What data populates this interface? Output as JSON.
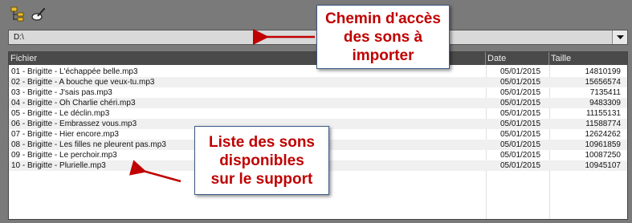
{
  "path": {
    "value": "D:\\"
  },
  "columns": {
    "file": "Fichier",
    "date": "Date",
    "size": "Taille"
  },
  "rows": [
    {
      "file": "01 - Brigitte - L'échappée belle.mp3",
      "date": "05/01/2015",
      "size": "14810199"
    },
    {
      "file": "02 - Brigitte - A bouche que veux-tu.mp3",
      "date": "05/01/2015",
      "size": "15656574"
    },
    {
      "file": "03 - Brigitte - J'sais pas.mp3",
      "date": "05/01/2015",
      "size": "7135411"
    },
    {
      "file": "04 - Brigitte - Oh Charlie chéri.mp3",
      "date": "05/01/2015",
      "size": "9483309"
    },
    {
      "file": "05 - Brigitte - Le déclin.mp3",
      "date": "05/01/2015",
      "size": "11155131"
    },
    {
      "file": "06 - Brigitte - Embrassez vous.mp3",
      "date": "05/01/2015",
      "size": "11588774"
    },
    {
      "file": "07 - Brigitte - Hier encore.mp3",
      "date": "05/01/2015",
      "size": "12624262"
    },
    {
      "file": "08 - Brigitte - Les filles ne pleurent pas.mp3",
      "date": "05/01/2015",
      "size": "10961859"
    },
    {
      "file": "09 - Brigitte - Le perchoir.mp3",
      "date": "05/01/2015",
      "size": "10087250"
    },
    {
      "file": "10 - Brigitte - Plurielle.mp3",
      "date": "05/01/2015",
      "size": "10945107"
    }
  ],
  "callouts": {
    "top": [
      "Chemin d'accès",
      "des sons à",
      "importer"
    ],
    "bottom": [
      "Liste des sons",
      "disponibles",
      "sur le support"
    ]
  },
  "icons": {
    "toolbar_left": "folder-tree-icon",
    "toolbar_right": "pen-icon",
    "dropdown": "chevron-down-icon"
  },
  "colors": {
    "callout_text": "#c00000",
    "arrow": "#c00000"
  }
}
